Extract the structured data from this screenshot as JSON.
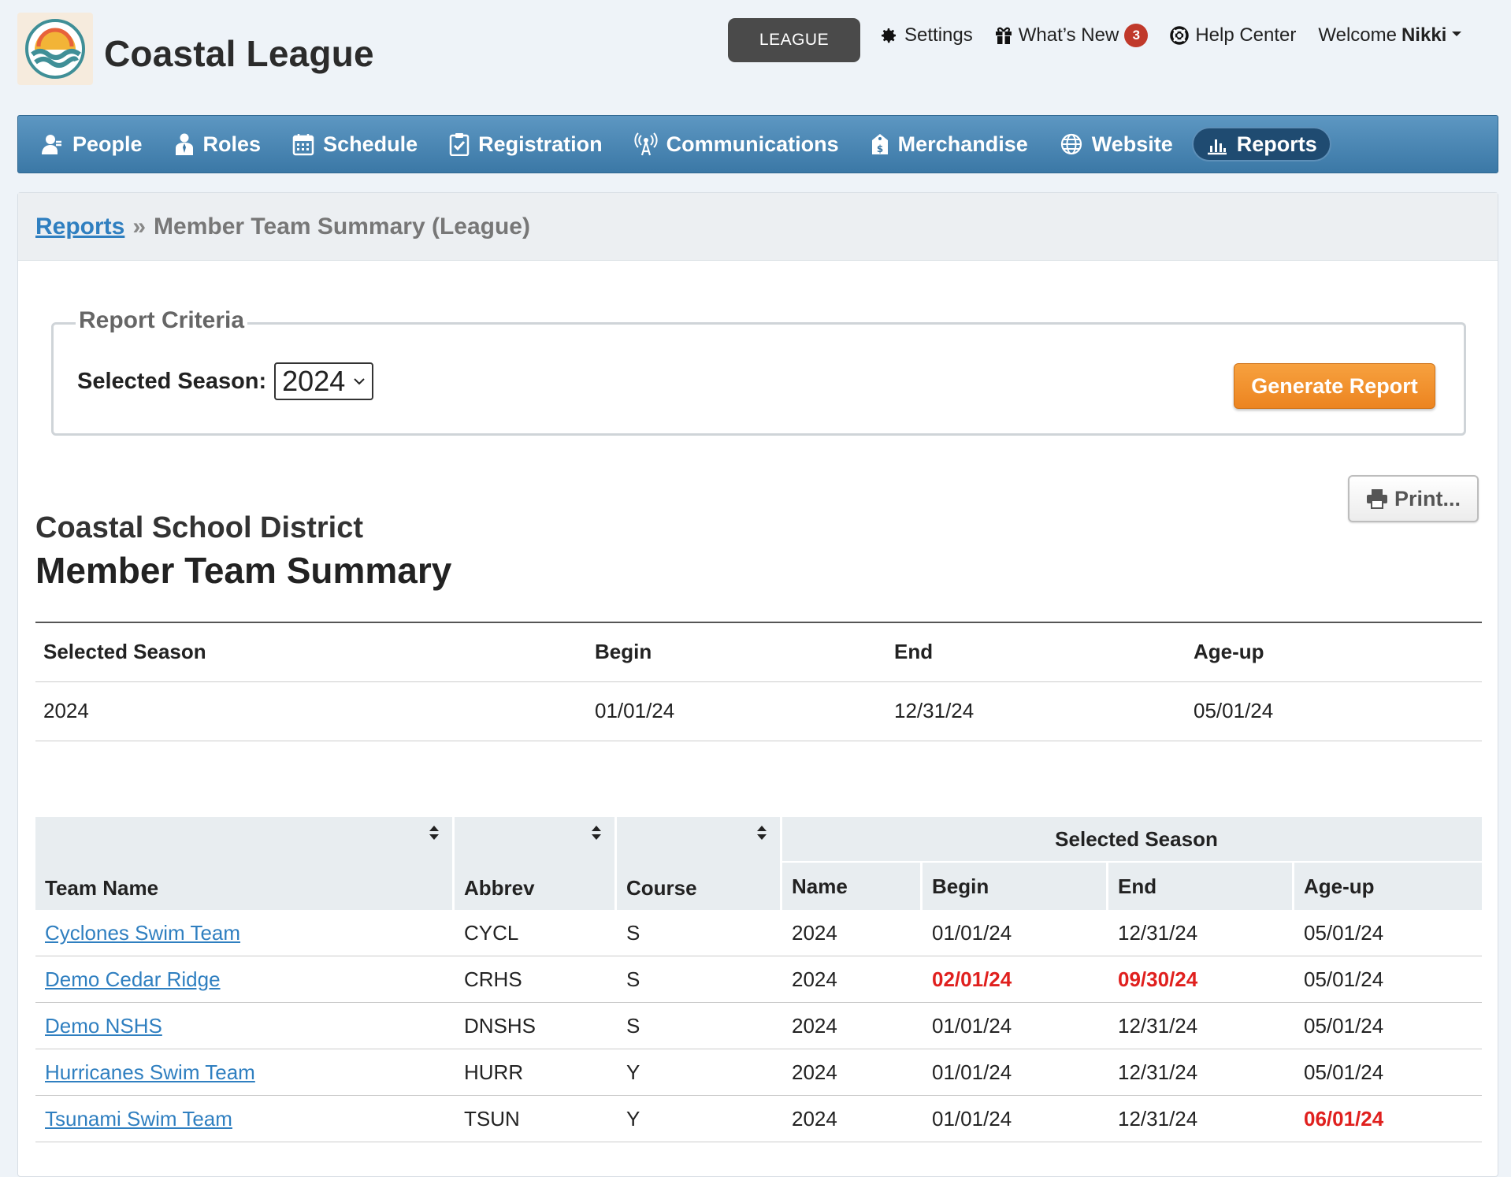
{
  "brand": {
    "name": "Coastal League"
  },
  "topbar": {
    "league_label": "LEAGUE",
    "settings_label": "Settings",
    "whats_new_label": "What’s New",
    "whats_new_count": "3",
    "help_label": "Help Center",
    "welcome_prefix": "Welcome",
    "user_name": "Nikki"
  },
  "nav": {
    "items": [
      {
        "label": "People",
        "icon": "person-icon"
      },
      {
        "label": "Roles",
        "icon": "role-icon"
      },
      {
        "label": "Schedule",
        "icon": "calendar-icon"
      },
      {
        "label": "Registration",
        "icon": "clipboard-check-icon"
      },
      {
        "label": "Communications",
        "icon": "broadcast-icon"
      },
      {
        "label": "Merchandise",
        "icon": "price-tag-icon"
      },
      {
        "label": "Website",
        "icon": "globe-icon"
      },
      {
        "label": "Reports",
        "icon": "bar-chart-icon",
        "active": true
      }
    ]
  },
  "breadcrumb": {
    "root": "Reports",
    "separator": "»",
    "current": "Member Team Summary (League)"
  },
  "criteria": {
    "legend": "Report Criteria",
    "season_label": "Selected Season:",
    "season_value": "2024",
    "generate_label": "Generate Report"
  },
  "print_label": "Print...",
  "report": {
    "district": "Coastal School District",
    "title": "Member Team Summary"
  },
  "season_summary": {
    "headers": [
      "Selected Season",
      "Begin",
      "End",
      "Age-up"
    ],
    "row": [
      "2024",
      "01/01/24",
      "12/31/24",
      "05/01/24"
    ]
  },
  "teams": {
    "group_header": "Selected Season",
    "headers": [
      "Team Name",
      "Abbrev",
      "Course",
      "Name",
      "Begin",
      "End",
      "Age-up"
    ],
    "rows": [
      {
        "team": "Cyclones Swim Team",
        "abbrev": "CYCL",
        "course": "S",
        "name": "2024",
        "begin": "01/01/24",
        "end": "12/31/24",
        "ageup": "05/01/24",
        "hl": []
      },
      {
        "team": "Demo Cedar Ridge",
        "abbrev": "CRHS",
        "course": "S",
        "name": "2024",
        "begin": "02/01/24",
        "end": "09/30/24",
        "ageup": "05/01/24",
        "hl": [
          "begin",
          "end"
        ]
      },
      {
        "team": "Demo NSHS",
        "abbrev": "DNSHS",
        "course": "S",
        "name": "2024",
        "begin": "01/01/24",
        "end": "12/31/24",
        "ageup": "05/01/24",
        "hl": []
      },
      {
        "team": "Hurricanes Swim Team",
        "abbrev": "HURR",
        "course": "Y",
        "name": "2024",
        "begin": "01/01/24",
        "end": "12/31/24",
        "ageup": "05/01/24",
        "hl": []
      },
      {
        "team": "Tsunami Swim Team",
        "abbrev": "TSUN",
        "course": "Y",
        "name": "2024",
        "begin": "01/01/24",
        "end": "12/31/24",
        "ageup": "06/01/24",
        "hl": [
          "ageup"
        ]
      }
    ]
  },
  "colors": {
    "nav": "#3b78a6",
    "link": "#2f7fc0",
    "highlight": "#e0201e",
    "accent": "#ec8420"
  }
}
